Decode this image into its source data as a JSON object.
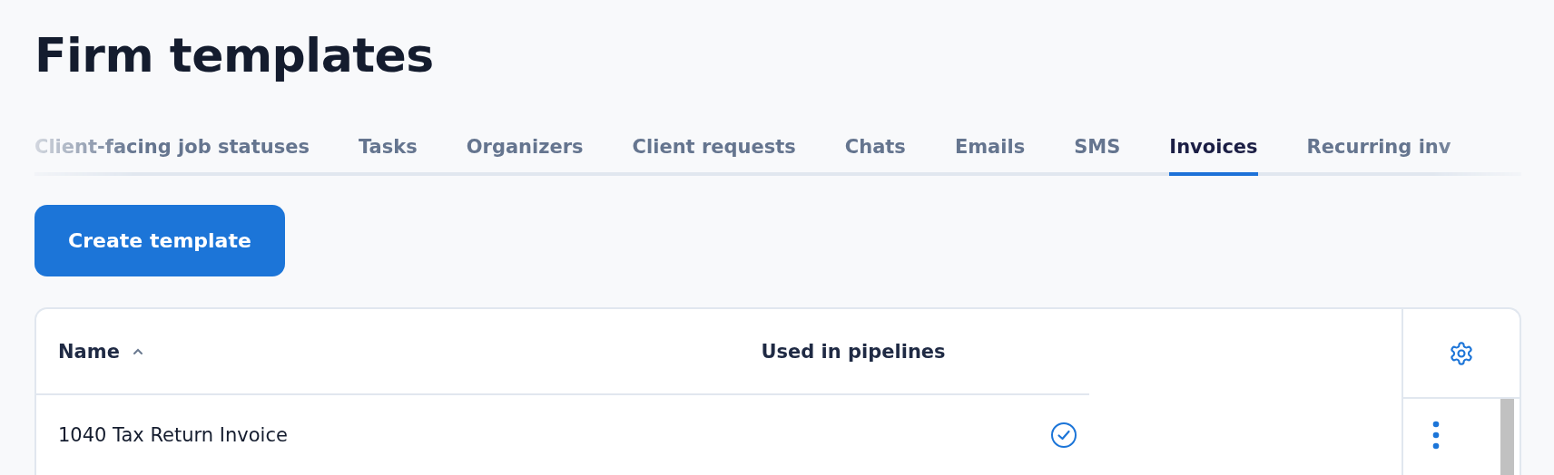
{
  "page": {
    "title": "Firm templates"
  },
  "tabs": [
    {
      "label": "Client-facing job statuses",
      "selected": false
    },
    {
      "label": "Tasks",
      "selected": false
    },
    {
      "label": "Organizers",
      "selected": false
    },
    {
      "label": "Client requests",
      "selected": false
    },
    {
      "label": "Chats",
      "selected": false
    },
    {
      "label": "Emails",
      "selected": false
    },
    {
      "label": "SMS",
      "selected": false
    },
    {
      "label": "Invoices",
      "selected": true
    },
    {
      "label": "Recurring inv",
      "selected": false
    }
  ],
  "create_button": "Create template",
  "table": {
    "columns": [
      {
        "label": "Name",
        "sort_ascending": true
      },
      {
        "label": "Used in pipelines"
      }
    ],
    "rows": [
      {
        "name": "1040 Tax Return Invoice",
        "used_in_pipelines": true
      }
    ]
  }
}
